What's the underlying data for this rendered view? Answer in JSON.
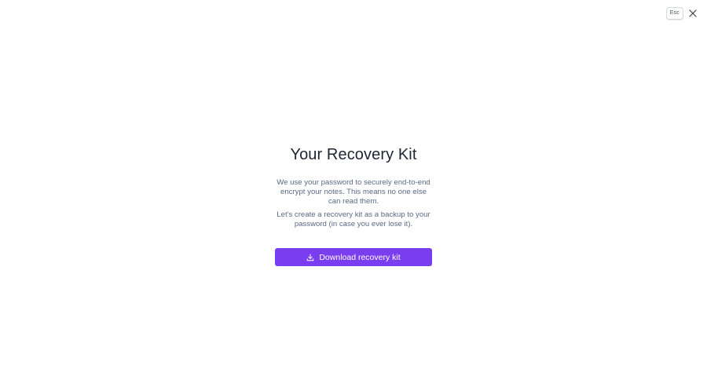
{
  "dialog": {
    "esc_label": "Esc",
    "title": "Your Recovery Kit",
    "paragraph_1": "We use your password to securely end-to-end encrypt your notes. This means no one else can read them.",
    "paragraph_2": "Let's create a recovery kit as a backup to your password (in case you ever lose it).",
    "download_button_label": "Download recovery kit"
  },
  "icons": {
    "close": "close-icon",
    "download": "download-icon"
  },
  "colors": {
    "accent": "#7a3df0",
    "title": "#1d2531",
    "body_text": "#5b6a86",
    "background": "#ffffff"
  }
}
